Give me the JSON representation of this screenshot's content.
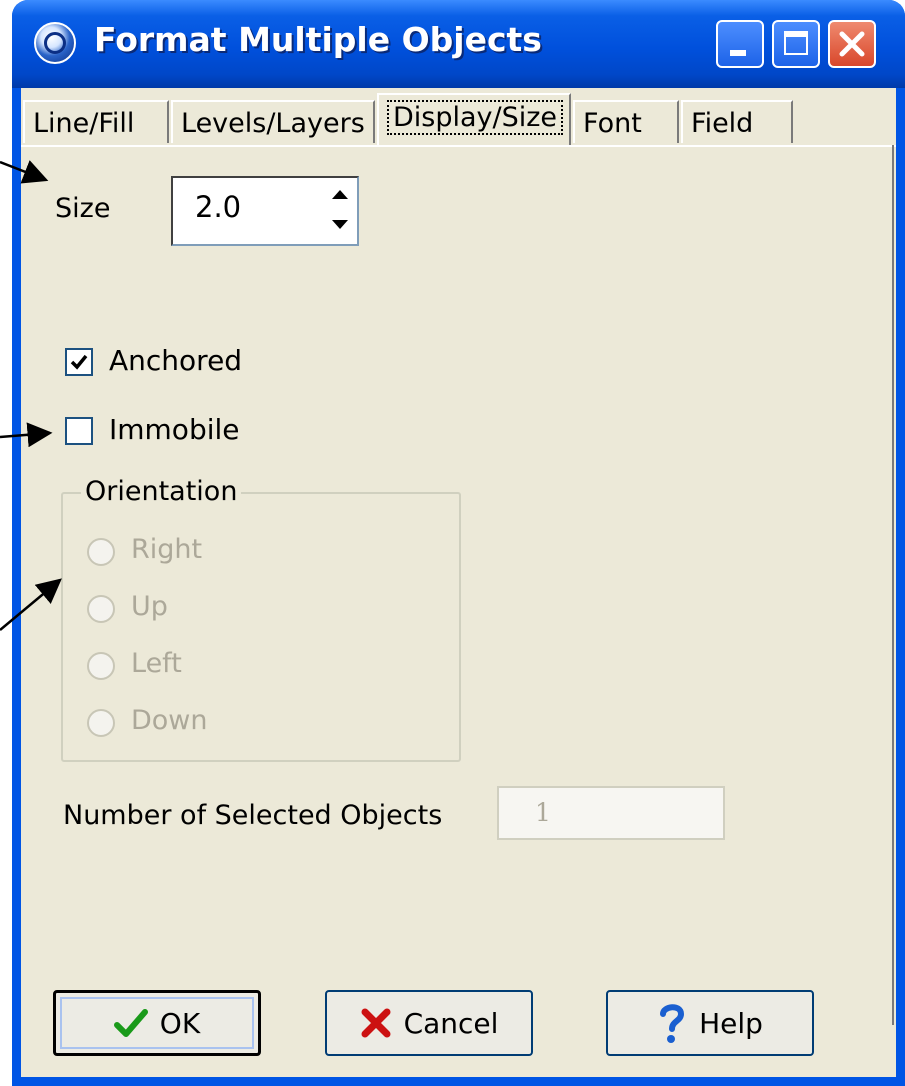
{
  "window": {
    "title": "Format Multiple Objects"
  },
  "tabs": [
    {
      "label": "Line/Fill"
    },
    {
      "label": "Levels/Layers"
    },
    {
      "label": "Display/Size"
    },
    {
      "label": "Font"
    },
    {
      "label": "Field"
    }
  ],
  "active_tab": "Display/Size",
  "size": {
    "label": "Size",
    "value": "2.0"
  },
  "checkboxes": {
    "anchored": {
      "label": "Anchored",
      "checked": true
    },
    "immobile": {
      "label": "Immobile",
      "checked": false
    }
  },
  "orientation": {
    "legend": "Orientation",
    "enabled": false,
    "options": [
      {
        "label": "Right"
      },
      {
        "label": "Up"
      },
      {
        "label": "Left"
      },
      {
        "label": "Down"
      }
    ]
  },
  "selected_objects": {
    "label": "Number of Selected Objects",
    "value": "1"
  },
  "buttons": {
    "ok": "OK",
    "cancel": "Cancel",
    "help": "Help"
  },
  "colors": {
    "titlebar": "#0050dc",
    "dialog_bg": "#ece9d8",
    "close_button": "#d9472b"
  }
}
